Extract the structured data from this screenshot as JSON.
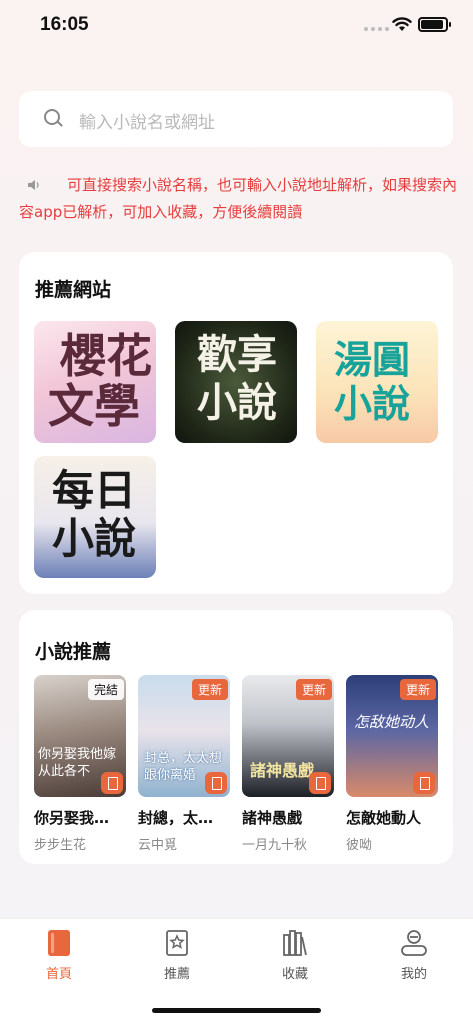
{
  "status_bar": {
    "time": "16:05"
  },
  "search": {
    "placeholder": "輸入小說名或網址"
  },
  "notice": {
    "text": "可直接搜索小說名稱，也可輸入小說地址解析，如果搜索內容app已解析，可加入收藏，方便後續閱讀"
  },
  "recommended_sites": {
    "title": "推薦網站",
    "sites": [
      {
        "line1": "櫻花",
        "line2": "文學"
      },
      {
        "line1": "歡享",
        "line2": "小說"
      },
      {
        "line1": "湯圓",
        "line2": "小說"
      },
      {
        "line1": "每日",
        "line2": "小說"
      }
    ]
  },
  "novel_recommend": {
    "title": "小說推薦",
    "books": [
      {
        "tag": "完結",
        "title": "你另娶我他嫁，從此各不相干",
        "title_short": "你另娶我…",
        "author": "步步生花",
        "cover_text": "你另娶我他嫁 从此各不"
      },
      {
        "tag": "更新",
        "title": "封總，太太想跟你離婚",
        "title_short": "封總，太…",
        "author": "云中覓",
        "cover_text": "封总，太太想跟你离婚"
      },
      {
        "tag": "更新",
        "title": "諸神愚戲",
        "title_short": "諸神愚戲",
        "author": "一月九十秋",
        "cover_text": "諸神愚戲"
      },
      {
        "tag": "更新",
        "title": "怎敵她動人",
        "title_short": "怎敵她動人",
        "author": "彼呦",
        "cover_text": "怎敌她动人"
      }
    ]
  },
  "tabs": [
    {
      "label": "首頁",
      "active": true
    },
    {
      "label": "推薦",
      "active": false
    },
    {
      "label": "收藏",
      "active": false
    },
    {
      "label": "我的",
      "active": false
    }
  ],
  "colors": {
    "accent": "#e8673d",
    "notice": "#e53d3d"
  }
}
